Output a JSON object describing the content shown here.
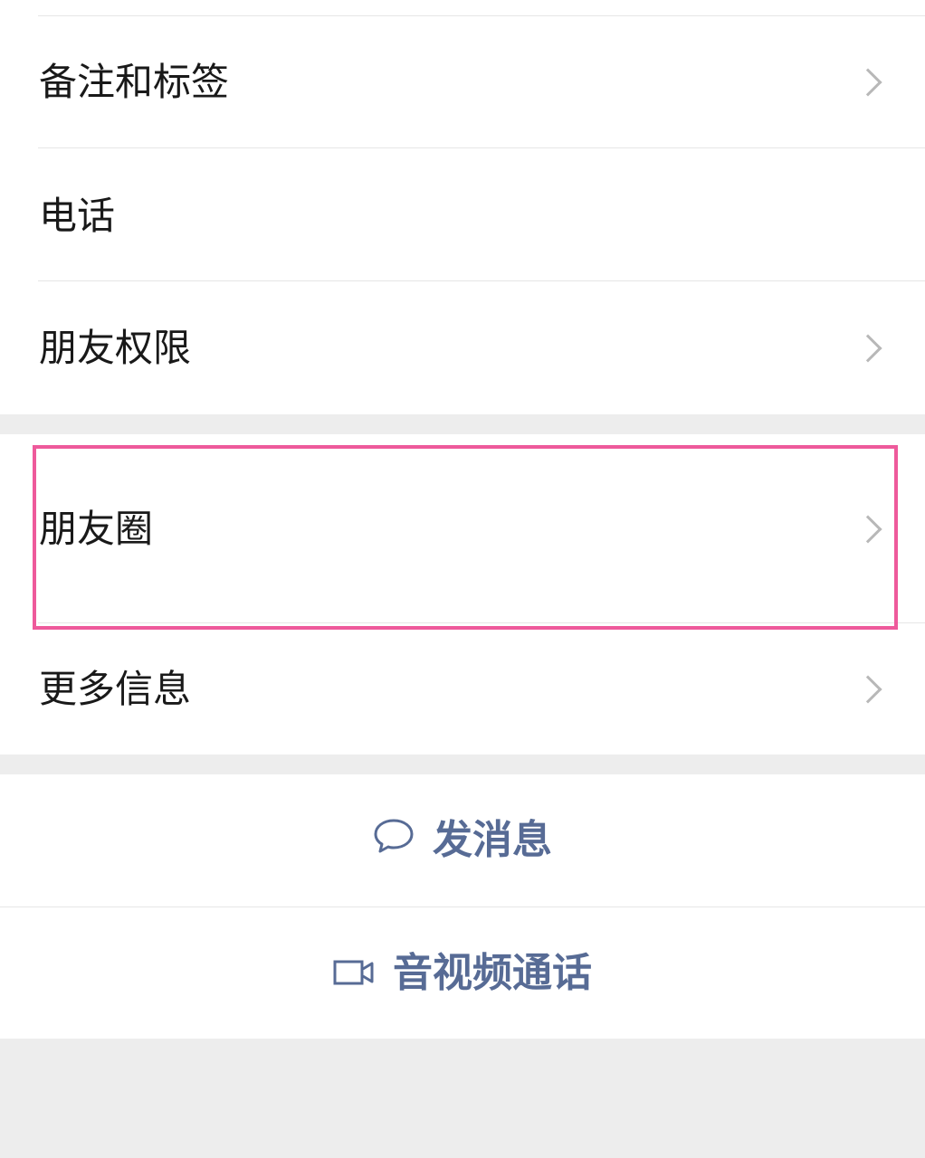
{
  "contact_settings": {
    "rows": [
      {
        "label": "备注和标签",
        "has_chevron": true
      },
      {
        "label": "电话",
        "has_chevron": false
      },
      {
        "label": "朋友权限",
        "has_chevron": true
      }
    ],
    "moments_row": {
      "label": "朋友圈",
      "has_chevron": true
    },
    "more_info_row": {
      "label": "更多信息",
      "has_chevron": true
    }
  },
  "actions": {
    "send_message": {
      "label": "发消息",
      "icon": "chat-bubble-icon"
    },
    "video_call": {
      "label": "音视频通话",
      "icon": "video-camera-icon"
    }
  },
  "highlight": {
    "target": "朋友圈",
    "color": "#ee5a9b"
  },
  "colors": {
    "background": "#ededed",
    "row_background": "#ffffff",
    "text": "#191919",
    "action_text": "#576b95",
    "chevron": "#b8b8b8"
  }
}
